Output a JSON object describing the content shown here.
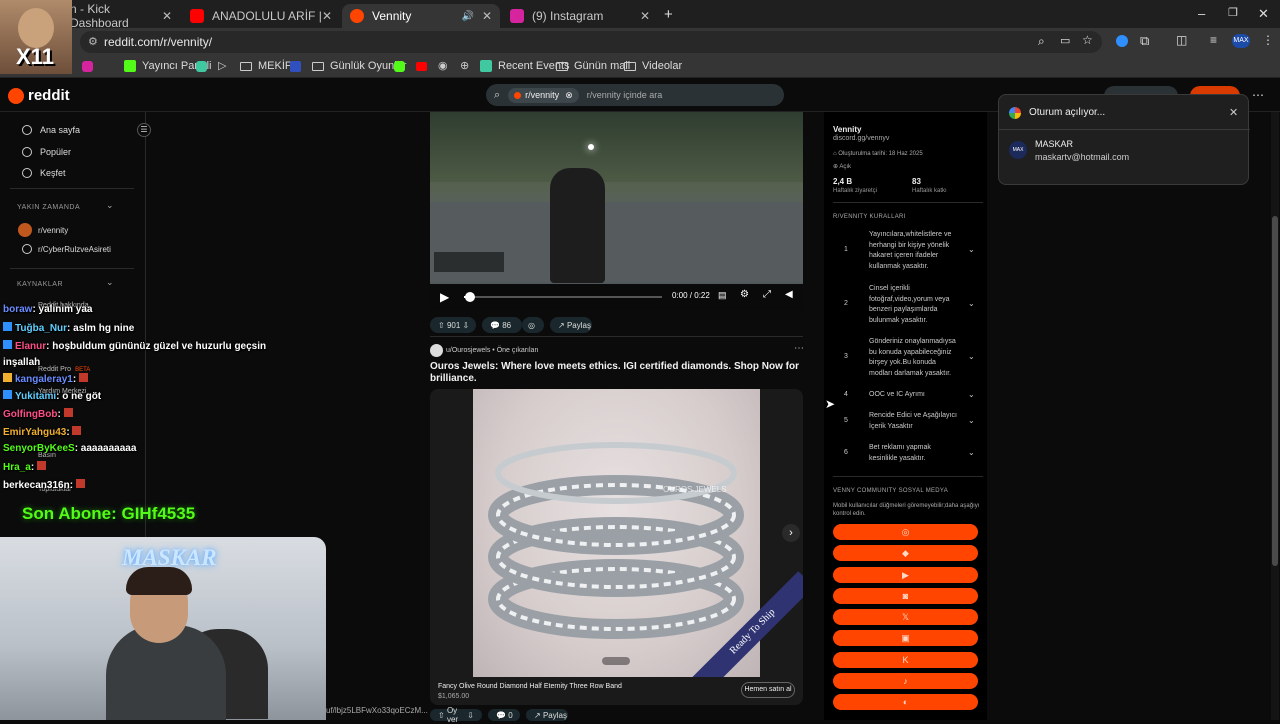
{
  "browser": {
    "tabs": [
      {
        "label": "n - Kick Dashboard",
        "color": "#53fc18"
      },
      {
        "label": "ANADOLULU ARİF | Madara Ol...",
        "color": "#ff0000"
      },
      {
        "label": "Vennity",
        "color": "#ff4500"
      },
      {
        "label": "(9) Instagram",
        "color": "#d6249f"
      }
    ],
    "url": "reddit.com/r/vennity/",
    "bookmarks": [
      {
        "label": "Yayıncı Paneli",
        "kind": "kick"
      },
      {
        "label": "MEKİP",
        "kind": "folder"
      },
      {
        "label": "Günlük Oyunlar",
        "kind": "folder"
      },
      {
        "label": "Recent Events",
        "kind": "app"
      },
      {
        "label": "Günün mali",
        "kind": "folder"
      },
      {
        "label": "Videolar",
        "kind": "folder"
      }
    ],
    "avatar_initials": "MAX"
  },
  "reddit": {
    "logo": "reddit",
    "search_chip": "r/vennity",
    "search_placeholder": "r/vennity içinde ara",
    "nav": [
      "Ana sayfa",
      "Popüler",
      "Keşfet"
    ],
    "recent_title": "YAKIN ZAMANDA",
    "recent": [
      "r/vennity",
      "r/CyberRulzveAsireti"
    ],
    "resources_title": "KAYNAKLAR",
    "resources": [
      "Reddit hakkında",
      "Reddit Pro",
      "Yardım Merkezi",
      "Basın",
      "Topluluklar"
    ],
    "pro_badge": "BETA"
  },
  "chat": [
    {
      "user": "boraw",
      "text": ": yalinim yaa",
      "color": "#6a8cff"
    },
    {
      "user": "Tuğba_Nur",
      "text": ": aslm hg nine",
      "color": "#5fd0ff"
    },
    {
      "user": "Elanur",
      "text": ": hoşbuldum gününüz güzel ve huzurlu geçsin",
      "color": "#ff4f87"
    },
    {
      "user": "",
      "text": "inşallah",
      "color": "#ffffff"
    },
    {
      "user": "kangaleray1",
      "text": ":",
      "color": "#6a8cff"
    },
    {
      "user": "Yukitami",
      "text": ": o ne göt",
      "color": "#5fd0ff"
    },
    {
      "user": "GolfingBob",
      "text": ":",
      "color": "#ff4f87"
    },
    {
      "user": "EmirYahgu43",
      "text": ":",
      "color": "#f0b030"
    },
    {
      "user": "SenyorByKeeS",
      "text": ": aaaaaaaaaa",
      "color": "#53fc18"
    },
    {
      "user": "Hra_a",
      "text": ":",
      "color": "#53fc18"
    },
    {
      "user": "berkecan316n",
      "text": ":",
      "color": "#ffffff"
    }
  ],
  "last_sub": "Son Abone: GIHf4535",
  "cam_sign": "MASKAR",
  "video": {
    "time": "0:00 / 0:22",
    "upvotes": "901",
    "comments": "86",
    "share": "Paylaş",
    "progress": 0.03
  },
  "ad": {
    "user": "u/Ourosjewels",
    "promoted": "Öne çıkarılan",
    "title": "Ouros Jewels: Where love meets ethics. IGI certified diamonds. Shop Now for brilliance.",
    "product": "Fancy Olive Round Diamond Half Eternity Three Row Band",
    "price": "$1,065.00",
    "cta": "Hemen satın al",
    "ribbon": "Ready To Ship",
    "watermark": "OUROS JEWELS",
    "vote": "Oy ver",
    "comments": "0",
    "share": "Paylaş",
    "bottom_hash": "uf/lbjz5LBFwXo33qoECzM..."
  },
  "community": {
    "name": "Vennity",
    "link": "discord.gg/vennyv",
    "created": "Oluşturulma tarihi: 18 Haz 2025",
    "visibility": "Açık",
    "stat1_value": "2,4 B",
    "stat1_label": "Haftalık ziyaretçi",
    "stat2_value": "83",
    "stat2_label": "Haftalık katkı",
    "rules_title": "R/VENNITY KURALLARI",
    "rules": [
      "Yayıncılara,whitelistlere ve herhangi bir kişiye yönelik hakaret içeren ifadeler kullanmak yasaktır.",
      "Cinsel içerikli fotoğraf,video,yorum veya benzeri paylaşımlarda bulunmak yasaktır.",
      "Gönderiniz onaylanmadıysa bu konuda yapabileceğiniz birşey yok.Bu konuda modları darlamak yasaktır.",
      "OOC ve IC Ayrımı",
      "Rencide Edici ve Aşağılayıcı İçerik Yasaktır",
      "Bet reklamı yapmak kesinlikle yasaktır."
    ],
    "social_title": "VENNY COMMUNITY SOSYAL MEDYA",
    "social_note": "Mobil kullanıcılar düğmeleri göremeyebilir;daha aşağıyı kontrol edin.",
    "social_buttons": [
      "◎",
      "◆",
      "▶",
      "◙",
      "𝕏",
      "▣",
      "K",
      "♪",
      "◐"
    ]
  },
  "google": {
    "title": "Oturum açılıyor...",
    "name": "MASKAR",
    "email": "maskartv@hotmail.com"
  }
}
